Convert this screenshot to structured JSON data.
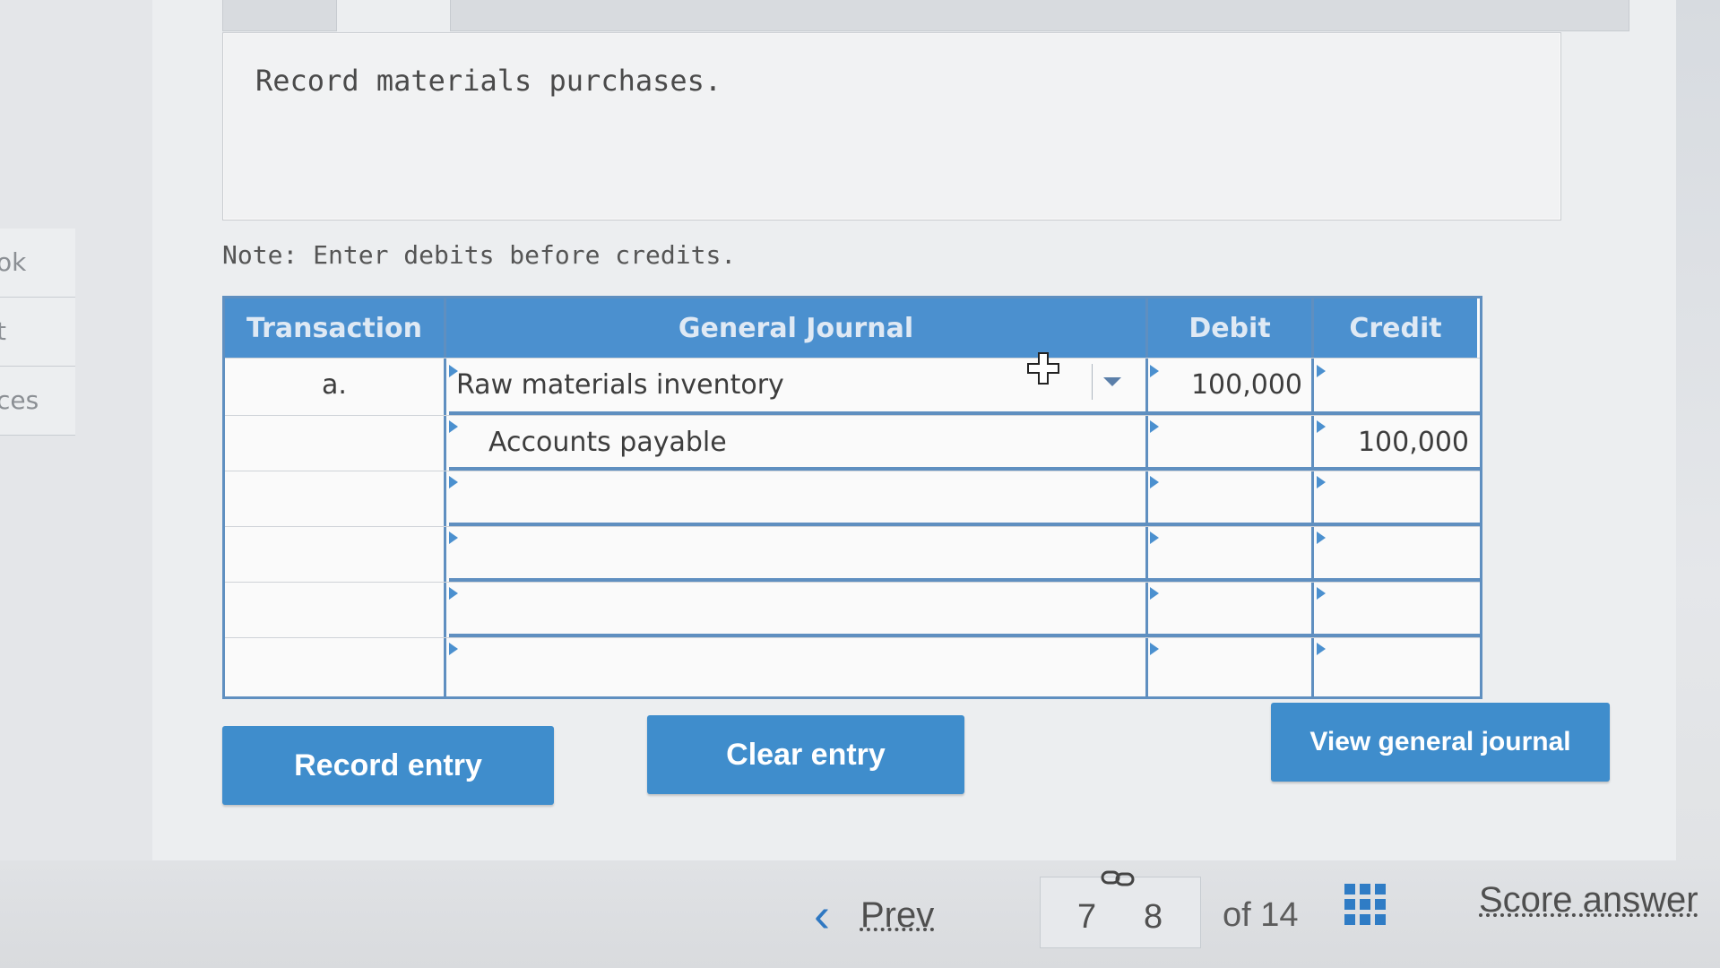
{
  "sidebar": {
    "items": [
      {
        "label": "ok"
      },
      {
        "label": "t"
      },
      {
        "label": "ces"
      }
    ]
  },
  "prompt": {
    "text": "Record materials purchases."
  },
  "note": {
    "text": "Note: Enter debits before credits."
  },
  "journal": {
    "headers": {
      "transaction": "Transaction",
      "general_journal": "General Journal",
      "debit": "Debit",
      "credit": "Credit"
    },
    "rows": [
      {
        "transaction": "a.",
        "account": "Raw materials inventory",
        "debit": "100,000",
        "credit": ""
      },
      {
        "transaction": "",
        "account": "Accounts payable",
        "debit": "",
        "credit": "100,000"
      },
      {
        "transaction": "",
        "account": "",
        "debit": "",
        "credit": ""
      },
      {
        "transaction": "",
        "account": "",
        "debit": "",
        "credit": ""
      },
      {
        "transaction": "",
        "account": "",
        "debit": "",
        "credit": ""
      },
      {
        "transaction": "",
        "account": "",
        "debit": "",
        "credit": ""
      }
    ]
  },
  "buttons": {
    "record_entry": "Record entry",
    "clear_entry": "Clear entry",
    "view_general_journal": "View general journal"
  },
  "footer": {
    "prev": "Prev",
    "current_page": "7",
    "next_page": "8",
    "of_total": "of 14",
    "score_answer": "Score answer"
  },
  "colors": {
    "accent": "#3f8dcc",
    "header": "#4b90cf"
  }
}
